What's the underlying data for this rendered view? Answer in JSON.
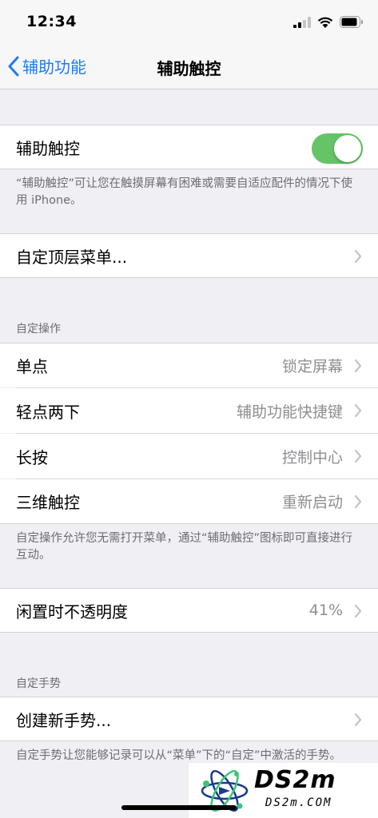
{
  "status": {
    "time": "12:34"
  },
  "nav": {
    "back_label": "辅助功能",
    "title": "辅助触控"
  },
  "assistive_touch": {
    "label": "辅助触控",
    "enabled": true,
    "footer": "“辅助触控”可让您在触摸屏幕有困难或需要自适应配件的情况下使用 iPhone。"
  },
  "customize_menu": {
    "label": "自定顶层菜单..."
  },
  "custom_actions": {
    "header": "自定操作",
    "items": [
      {
        "label": "单点",
        "value": "锁定屏幕"
      },
      {
        "label": "轻点两下",
        "value": "辅助功能快捷键"
      },
      {
        "label": "长按",
        "value": "控制中心"
      },
      {
        "label": "三维触控",
        "value": "重新启动"
      }
    ],
    "footer": "自定操作允许您无需打开菜单，通过“辅助触控”图标即可直接进行互动。"
  },
  "idle_opacity": {
    "label": "闲置时不透明度",
    "value": "41%"
  },
  "custom_gestures": {
    "header": "自定手势",
    "create_label": "创建新手势...",
    "footer": "自定手势让您能够记录可以从“菜单”下的“自定”中激活的手势。"
  },
  "watermark": {
    "logo": "DS2M",
    "site": "DS2M.COM"
  },
  "colors": {
    "accent": "#1c7cf4",
    "toggle_on": "#65c466",
    "background": "#efeff4"
  }
}
